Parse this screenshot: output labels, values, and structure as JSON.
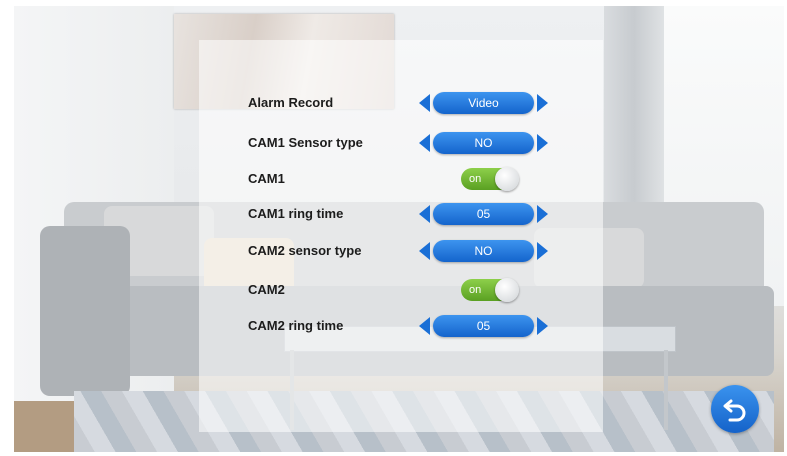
{
  "settings": [
    {
      "label": "Alarm Record",
      "type": "selector",
      "value": "Video"
    },
    {
      "label": "CAM1 Sensor type",
      "type": "selector",
      "value": "NO"
    },
    {
      "label": "CAM1",
      "type": "toggle",
      "value": "on"
    },
    {
      "label": "CAM1 ring time",
      "type": "selector",
      "value": "05"
    },
    {
      "label": "CAM2 sensor type",
      "type": "selector",
      "value": "NO"
    },
    {
      "label": "CAM2",
      "type": "toggle",
      "value": "on"
    },
    {
      "label": "CAM2 ring time",
      "type": "selector",
      "value": "05"
    }
  ],
  "icons": {
    "prev": "triangle-left-icon",
    "next": "triangle-right-icon",
    "back": "return-arrow-icon"
  },
  "colors": {
    "accent": "#1a6fd6",
    "toggle_on": "#6db52c",
    "label_text": "#1c1c1c"
  }
}
